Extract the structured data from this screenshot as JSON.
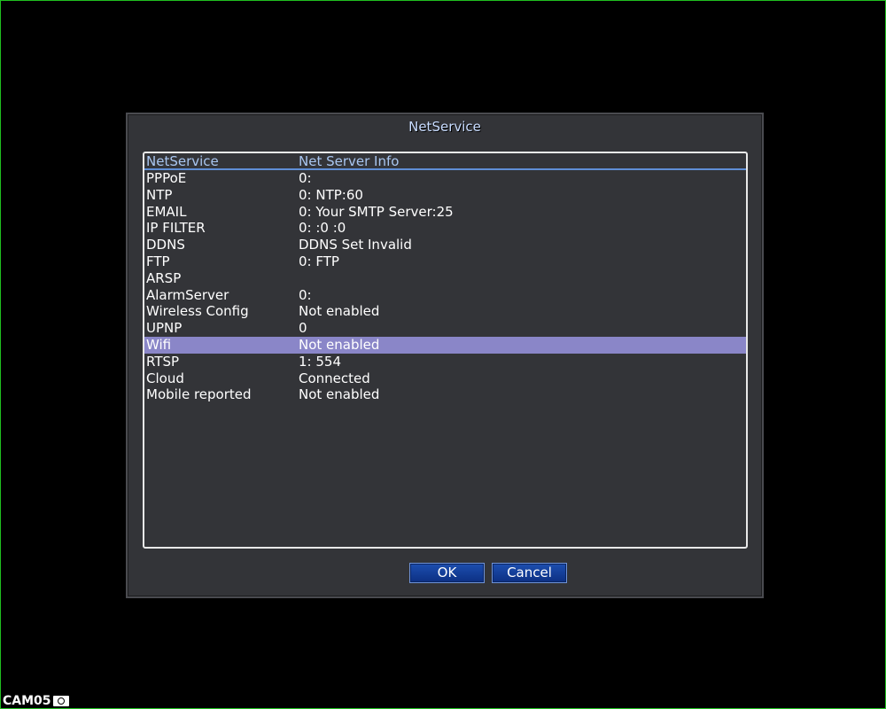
{
  "dialog": {
    "title": "NetService"
  },
  "list": {
    "header": {
      "col1": "NetService",
      "col2": "Net Server Info"
    },
    "rows": [
      {
        "name": "PPPoE",
        "info": "0:"
      },
      {
        "name": "NTP",
        "info": "0: NTP:60"
      },
      {
        "name": "EMAIL",
        "info": "0: Your SMTP Server:25"
      },
      {
        "name": "IP FILTER",
        "info": "0: :0 :0"
      },
      {
        "name": "DDNS",
        "info": "DDNS Set Invalid"
      },
      {
        "name": "FTP",
        "info": "0: FTP"
      },
      {
        "name": "ARSP",
        "info": ""
      },
      {
        "name": "AlarmServer",
        "info": "0:"
      },
      {
        "name": "Wireless Config",
        "info": "Not enabled"
      },
      {
        "name": "UPNP",
        "info": "0"
      },
      {
        "name": "Wifi",
        "info": "Not enabled",
        "selected": true
      },
      {
        "name": "RTSP",
        "info": "1: 554"
      },
      {
        "name": "Cloud",
        "info": "Connected"
      },
      {
        "name": "Mobile reported",
        "info": "Not enabled"
      }
    ]
  },
  "buttons": {
    "ok": "OK",
    "cancel": "Cancel"
  },
  "camera": {
    "label": "CAM05",
    "icon": "camera-icon"
  },
  "colors": {
    "selected_row": "#8a86c8",
    "header_text": "#a9c6f0",
    "button_blue": "#1d4fb0"
  }
}
